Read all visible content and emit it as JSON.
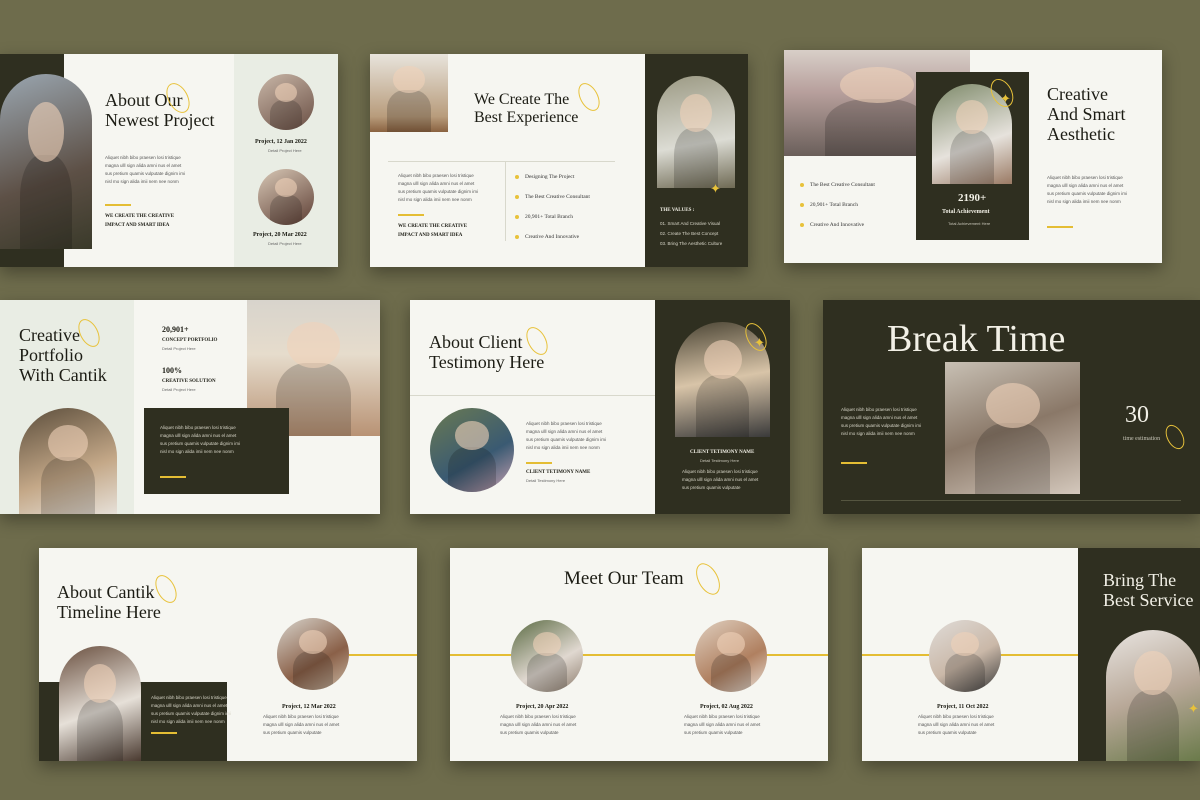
{
  "colors": {
    "page_bg": "#6e6c4c",
    "dark": "#2f2f20",
    "accent": "#e8c23a",
    "paper": "#f6f6f1"
  },
  "lorem": "Aliquet nibh bibo praesen losi tristique\nmagna ulll sign alida amni nus el amet\nsus pretium quamis vulputate dignim imi\nnisl mo sign alida imii nem nee nonm",
  "lorem_short": "Aliquet nibh bibo praesen losi tristique\nmagna ulll sign alida amni nus el amet\nsus pretium quamis vulputate",
  "detail": "Detail Project Here",
  "slide1": {
    "title": "About Our\nNewest Project",
    "tagline": "WE CREATE THE CREATIVE\nIMPACT AND SMART IDEA",
    "project1": "Project, 12 Jan 2022",
    "project2": "Project, 20 Mar 2022"
  },
  "slide2": {
    "title": "We Create The\nBest Experience",
    "tagline": "WE CREATE THE CREATIVE\nIMPACT AND SMART IDEA",
    "list": [
      "Designing The Project",
      "The Best Creative Consultant",
      "20,901+ Total Branch",
      "Creative And Innovative"
    ],
    "values_title": "THE VALUES :",
    "values": [
      "01. Smart And Creative Visual",
      "02. Create The Best Concept",
      "03. Bring The Aesthetic Culture"
    ]
  },
  "slide3": {
    "title": "Creative\nAnd Smart\nAesthetic",
    "list": [
      "The Best Creative Consultant",
      "20,901+ Total Branch",
      "Creative And Innovative"
    ],
    "stat": "2190+",
    "stat_label": "Total Achievement",
    "stat_sub": "Total Achievement Here"
  },
  "slide4": {
    "title": "Creative\nPortfolio\nWith Cantik",
    "stat1": "20,901+",
    "stat1_label": "CONCEPT PORTFOLIO",
    "stat2": "100%",
    "stat2_label": "CREATIVE SOLUTION"
  },
  "slide5": {
    "title": "About Client\nTestimony Here",
    "client": "CLIENT TETIMONY NAME",
    "client_sub": "Detail Testimony Here",
    "client2": "CLIENT TETIMONY NAME",
    "client2_sub": "Detail Testimony Here"
  },
  "slide6": {
    "title": "Break Time",
    "number": "30",
    "number_label": "time estimation"
  },
  "slide7": {
    "title": "About Cantik\nTimeline Here",
    "project": "Project, 12 Mar 2022"
  },
  "slide8": {
    "title": "Meet Our Team",
    "project1": "Project, 20 Apr 2022",
    "project2": "Project, 02 Aug 2022"
  },
  "slide9": {
    "title": "Bring The\nBest Service",
    "project": "Project, 11 Oct 2022"
  }
}
